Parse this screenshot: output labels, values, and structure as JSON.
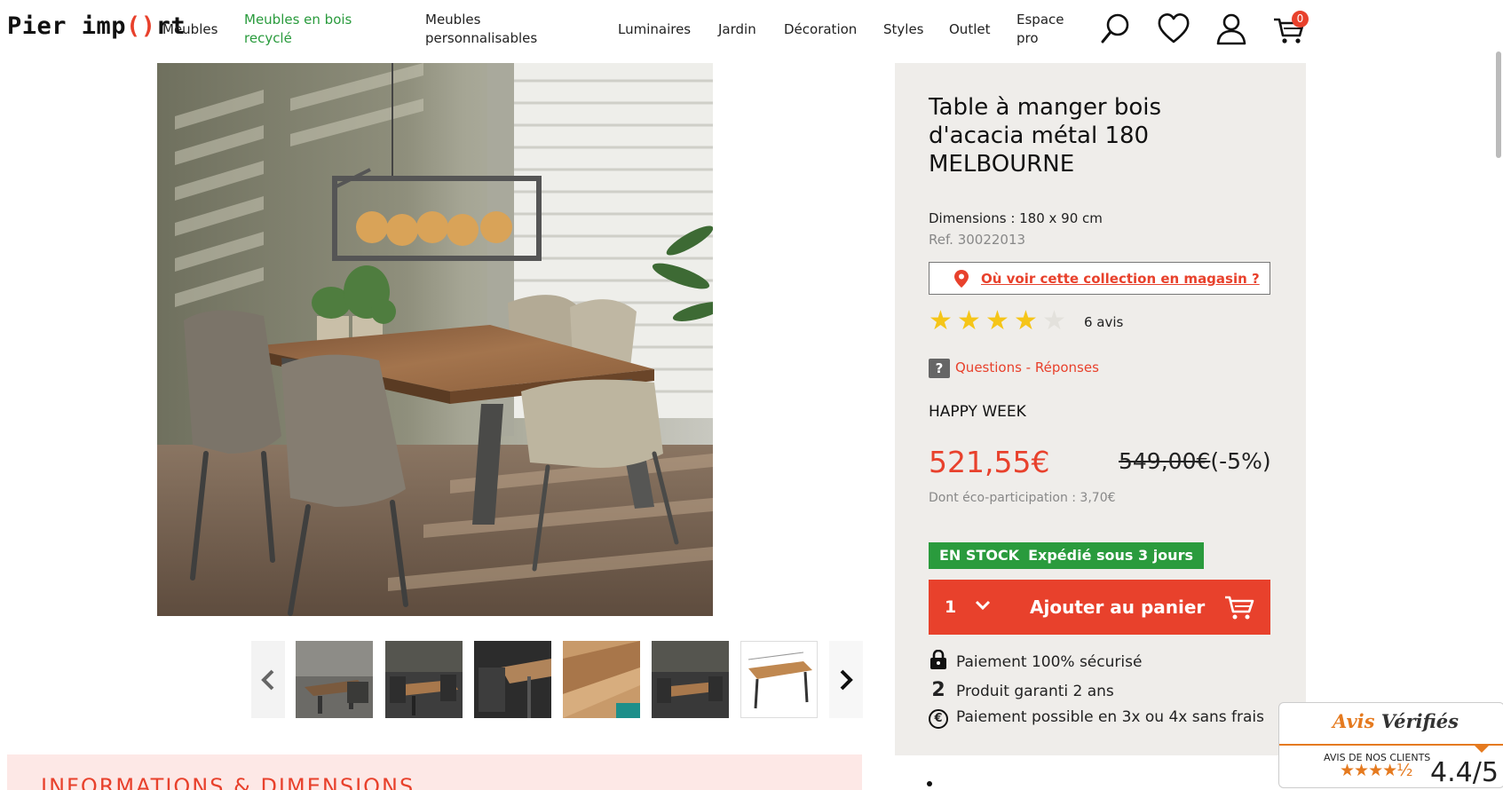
{
  "header": {
    "logo": {
      "part1": "Pier imp",
      "part2": "()",
      "part3": "rt"
    },
    "nav": [
      "Meubles",
      "Meubles en bois recyclé",
      "Meubles personnalisables",
      "Luminaires",
      "Jardin",
      "Décoration",
      "Styles",
      "Outlet",
      "Espace pro"
    ],
    "cart_count": "0"
  },
  "product": {
    "title": "Table à manger bois d'acacia métal 180 MELBOURNE",
    "dimensions": "Dimensions : 180 x 90 cm",
    "ref": "Ref. 30022013",
    "store_link": "Où voir cette collection en magasin ?",
    "rating": 4,
    "rating_max": 5,
    "reviews": "6 avis",
    "qa_icon": "?",
    "qa_link": "Questions - Réponses",
    "promo": "HAPPY WEEK",
    "price": "521,55€",
    "old_price": "549,00€",
    "discount": "(-5%)",
    "eco": "Dont éco-participation : 3,70€",
    "stock": "EN STOCK",
    "shipping": "Expédié sous 3 jours",
    "quantity": "1",
    "add_to_cart": "Ajouter au panier",
    "features": [
      {
        "icon": "lock-icon",
        "text": "Paiement 100% sécurisé"
      },
      {
        "icon": "two-icon",
        "glyph": "2",
        "text": "Produit garanti 2 ans"
      },
      {
        "icon": "euro-icon",
        "glyph": "€",
        "text": "Paiement possible en 3x ou 4x sans frais"
      }
    ]
  },
  "gallery": {
    "thumbnail_count": 6
  },
  "info_section": {
    "title": "INFORMATIONS & DIMENSIONS"
  },
  "avis_verifies": {
    "brand_a": "Avis",
    "brand_b": "Vérifiés",
    "subtitle": "AVIS DE NOS CLIENTS",
    "rating": 4.4,
    "score": "4.4/5"
  },
  "colors": {
    "accent": "#e8412c",
    "green": "#2a9b3d",
    "panel": "#efedea",
    "star": "#f5c518"
  }
}
